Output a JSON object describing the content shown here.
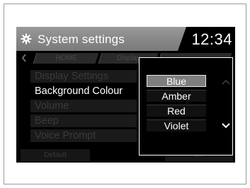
{
  "header": {
    "title": "System settings",
    "clock": "12:34",
    "icon": "gear-icon"
  },
  "tabs": [
    {
      "label": "HOME"
    },
    {
      "label": "Display"
    },
    {
      "label": ""
    }
  ],
  "menu": {
    "items": [
      {
        "label": "Display Settings",
        "state": "dimmed"
      },
      {
        "label": "Background Colour",
        "state": "active"
      },
      {
        "label": "Volume",
        "state": "dimmed"
      },
      {
        "label": "Beep",
        "state": "dimmed"
      },
      {
        "label": "Voice Prompt",
        "state": "dimmed"
      }
    ]
  },
  "buttons": {
    "default_label": "Default",
    "ok_label": "OK"
  },
  "popup": {
    "options": [
      {
        "label": "Blue",
        "selected": true
      },
      {
        "label": "Amber",
        "selected": false
      },
      {
        "label": "Red",
        "selected": false
      },
      {
        "label": "Violet",
        "selected": false
      }
    ]
  },
  "colors": {
    "header": "#8a8a8a",
    "screen": "#000000",
    "selected_option": "#7e7e7e",
    "text": "#ffffff"
  }
}
